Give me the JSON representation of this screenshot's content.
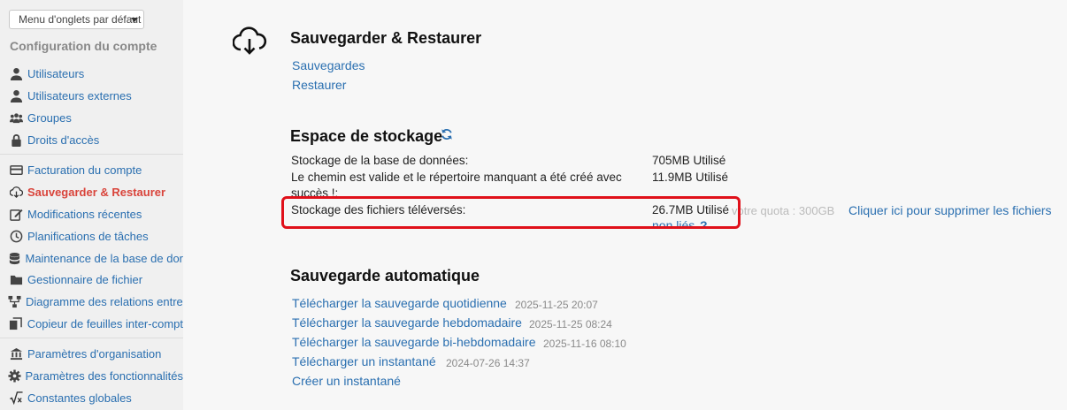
{
  "sidebar": {
    "tab_menu": "Menu d'onglets par défaut",
    "header": "Configuration du compte",
    "items": [
      {
        "label": "Utilisateurs",
        "icon": "user-icon"
      },
      {
        "label": "Utilisateurs externes",
        "icon": "user-icon"
      },
      {
        "label": "Groupes",
        "icon": "group-icon"
      },
      {
        "label": "Droits d'accès",
        "icon": "lock-icon"
      },
      {
        "label": "Facturation du compte",
        "icon": "billing-icon"
      },
      {
        "label": "Sauvegarder & Restaurer",
        "icon": "cloud-download-icon"
      },
      {
        "label": "Modifications récentes",
        "icon": "edit-icon"
      },
      {
        "label": "Planifications de tâches",
        "icon": "clock-icon"
      },
      {
        "label": "Maintenance de la base de dor",
        "icon": "database-icon"
      },
      {
        "label": "Gestionnaire de fichier",
        "icon": "folder-icon"
      },
      {
        "label": "Diagramme des relations entre",
        "icon": "diagram-icon"
      },
      {
        "label": "Copieur de feuilles inter-compt",
        "icon": "copy-icon"
      },
      {
        "label": "Paramètres d'organisation",
        "icon": "bank-icon"
      },
      {
        "label": "Paramètres des fonctionnalités",
        "icon": "gear-icon"
      },
      {
        "label": "Constantes globales",
        "icon": "sqrt-icon"
      }
    ]
  },
  "main": {
    "backup_title": "Sauvegarder & Restaurer",
    "backups_link": "Sauvegardes",
    "restore_link": "Restaurer",
    "storage_title": "Espace de stockage",
    "storage": {
      "db_label": "Stockage de la base de données:",
      "db_value": "705MB Utilisé",
      "path_label_1": "Le chemin est valide et le répertoire manquant a été créé avec",
      "path_label_2": "succès !:",
      "path_value": "11.9MB Utilisé",
      "files_label": "Stockage des fichiers téléversés:",
      "files_value": "26.7MB Utilisé",
      "quota": "votre quota : 300GB",
      "delete_link_1": "Cliquer ici pour supprimer les fichiers",
      "delete_link_2": "non liés",
      "help": "?"
    },
    "auto_title": "Sauvegarde automatique",
    "auto_items": [
      {
        "label": "Télécharger la sauvegarde quotidienne",
        "time": "2025-11-25 20:07"
      },
      {
        "label": "Télécharger la sauvegarde hebdomadaire",
        "time": "2025-11-25 08:24"
      },
      {
        "label": "Télécharger la sauvegarde bi-hebdomadaire",
        "time": "2025-11-16 08:10"
      },
      {
        "label": "Télécharger un instantané",
        "time": "2024-07-26 14:37"
      }
    ],
    "create_snapshot": "Créer un instantané"
  },
  "colors": {
    "link": "#2a6fb0",
    "active": "#d9443b",
    "highlight": "#e0101a"
  }
}
